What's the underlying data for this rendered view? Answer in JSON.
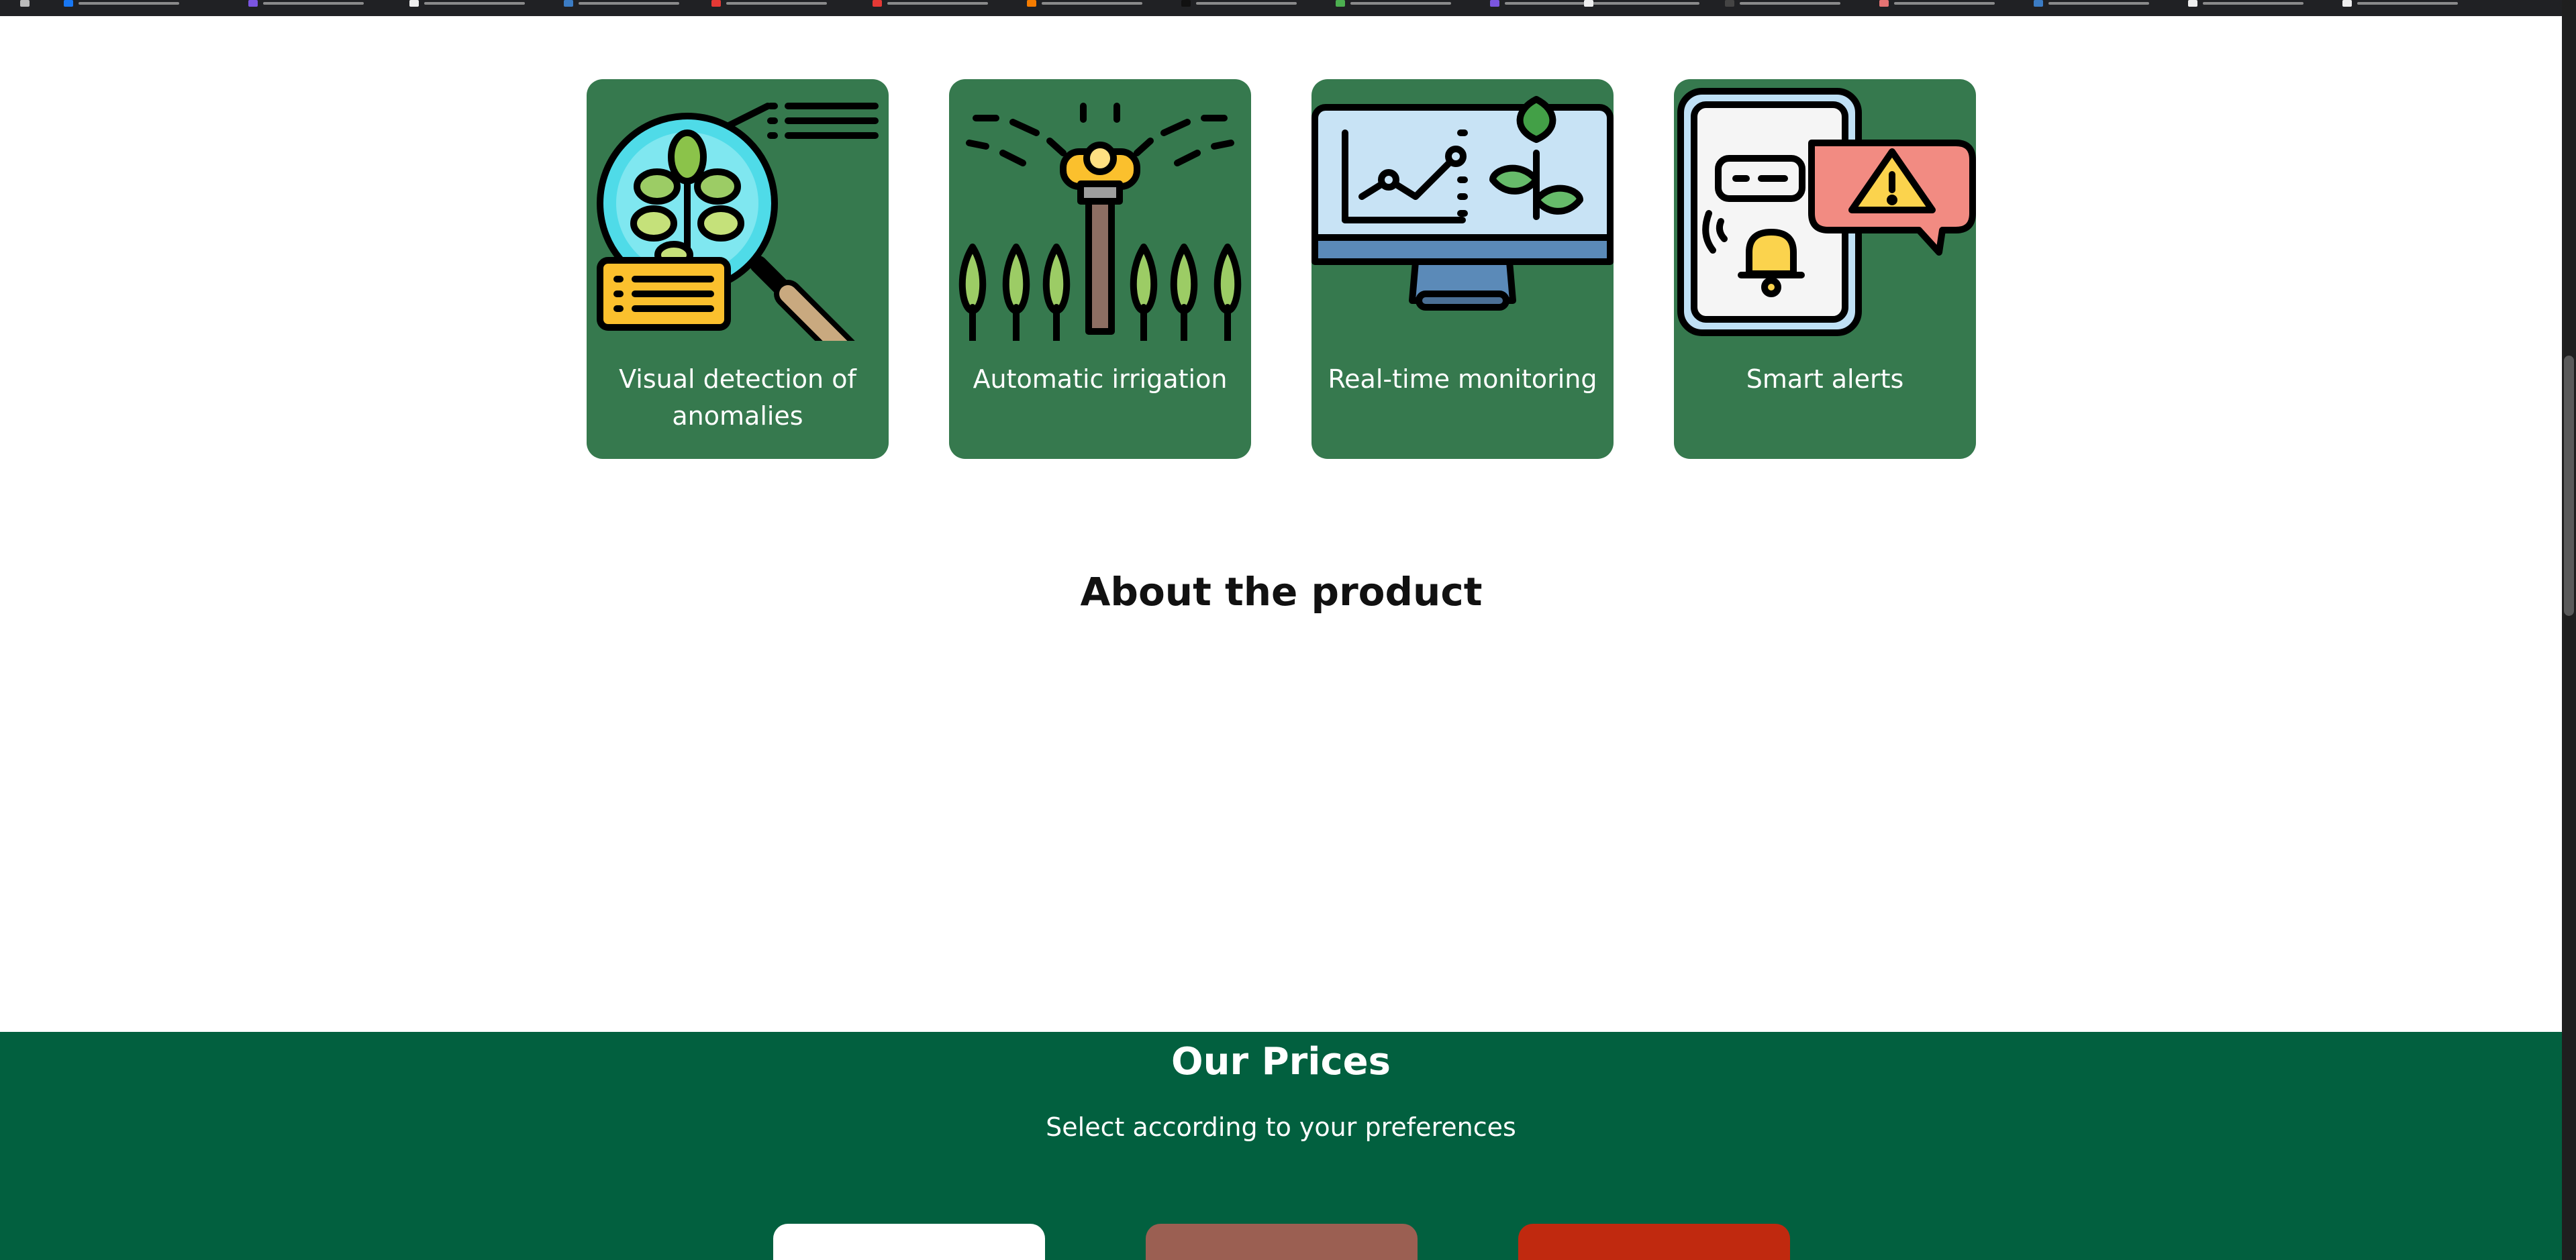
{
  "features": [
    {
      "icon": "plant-magnifier-icon",
      "label": "Visual detection of anomalies"
    },
    {
      "icon": "sprinkler-irrigation-icon",
      "label": "Automatic irrigation"
    },
    {
      "icon": "monitor-chart-icon",
      "label": "Real-time monitoring"
    },
    {
      "icon": "phone-alert-bell-icon",
      "label": "Smart alerts"
    }
  ],
  "about": {
    "title": "About the product"
  },
  "prices": {
    "title": "Our Prices",
    "subtitle": "Select according to your preferences",
    "plans": [
      {
        "label": "",
        "color": "#ffffff",
        "text_color": "#02603f"
      },
      {
        "label": "",
        "color": "#9b5f52",
        "text_color": "#ffffff"
      },
      {
        "label": "",
        "color": "#c0290f",
        "text_color": "#ffffff"
      }
    ]
  },
  "colors": {
    "card_green": "#36794e",
    "prices_green": "#02603f"
  }
}
